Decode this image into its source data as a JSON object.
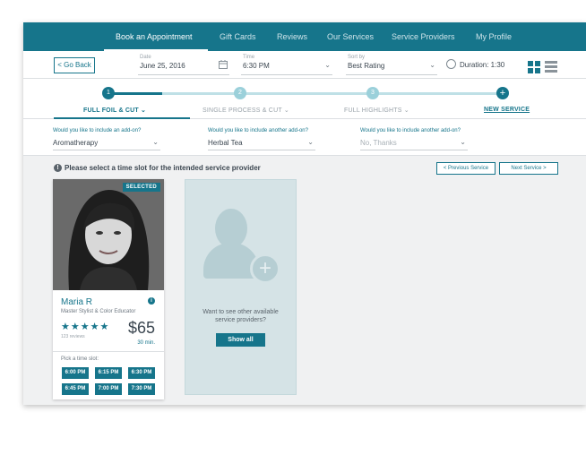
{
  "nav": {
    "items": [
      "Book an Appointment",
      "Gift Cards",
      "Reviews",
      "Our Services",
      "Service Providers",
      "My Profile"
    ],
    "active": "Book an Appointment"
  },
  "filters": {
    "go_back": "< Go Back",
    "date_label": "Date",
    "date_value": "June 25, 2016",
    "time_label": "Time",
    "time_value": "6:30 PM",
    "sort_label": "Sort by",
    "sort_value": "Best Rating",
    "duration": "Duration: 1:30"
  },
  "steps": [
    {
      "num": "1",
      "label": "FULL FOIL & CUT"
    },
    {
      "num": "2",
      "label": "SINGLE PROCESS & CUT"
    },
    {
      "num": "3",
      "label": "FULL HIGHLIGHTS"
    }
  ],
  "new_service": {
    "icon": "+",
    "label": "NEW SERVICE"
  },
  "addons": [
    {
      "label": "Would you like to include an add-on?",
      "value": "Aromatherapy"
    },
    {
      "label": "Would you like to include another add-on?",
      "value": "Herbal Tea"
    },
    {
      "label": "Would you like to include another add-on?",
      "value": "No, Thanks"
    }
  ],
  "slots_header": {
    "title": "Please select a time slot for the intended service provider",
    "prev": "< Previous Service",
    "next": "Next Service >"
  },
  "provider": {
    "badge": "SELECTED",
    "name": "Maria R",
    "role": "Master Stylist & Color Educator",
    "stars": "★★★★★",
    "rating": 5,
    "reviews": "123 reviews",
    "price": "$65",
    "duration": "30 min.",
    "pick_label": "Pick a time slot:",
    "slots": [
      "6:00 PM",
      "6:15 PM",
      "6:30 PM",
      "6:45 PM",
      "7:00 PM",
      "7:30 PM"
    ]
  },
  "other": {
    "text": "Want to see other available service providers?",
    "button": "Show all"
  },
  "colors": {
    "accent": "#16758b",
    "background": "#f0f1f2"
  }
}
